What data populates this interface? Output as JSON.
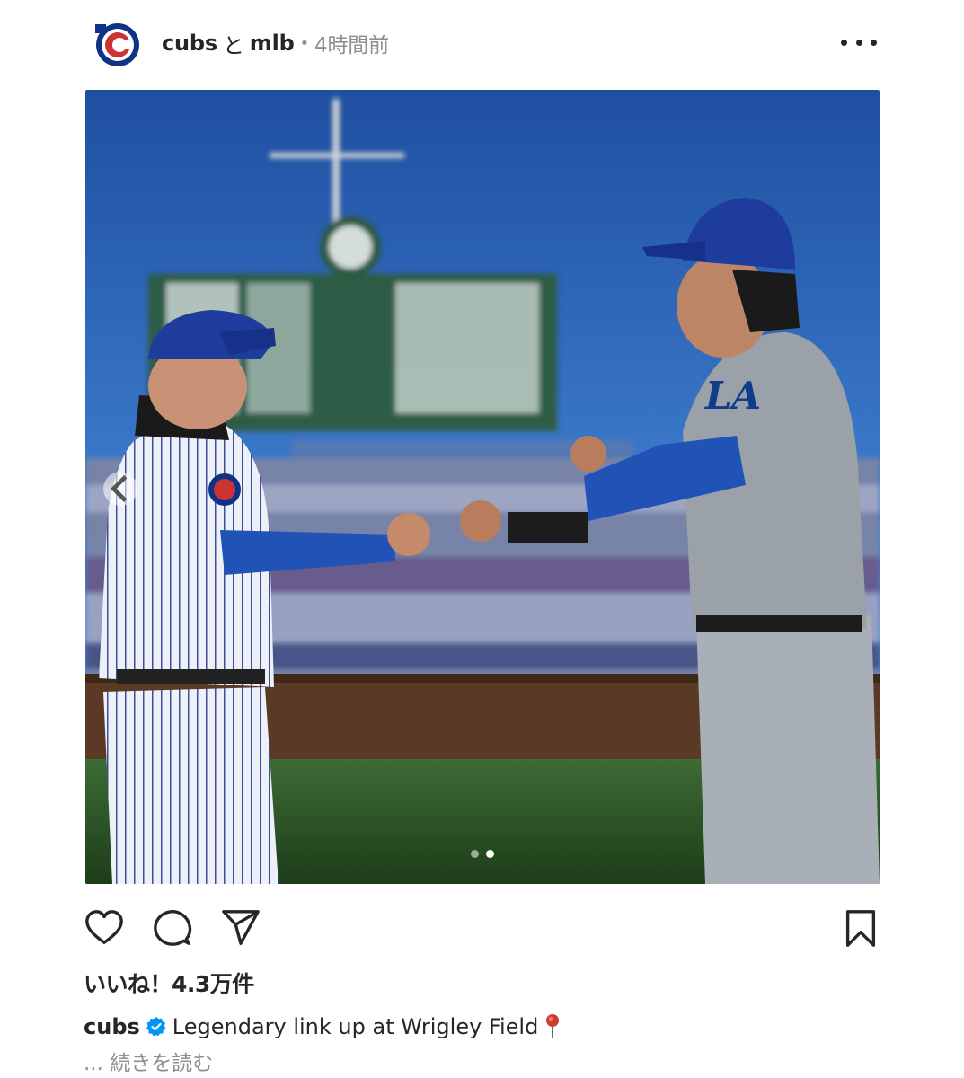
{
  "post": {
    "author": "cubs",
    "conjunction": "と",
    "collaborator": "mlb",
    "separator": "•",
    "time": "4時間前",
    "avatar_icon": "cubs-logo",
    "more_icon": "more-horizontal-icon"
  },
  "photo": {
    "description_icon": "post-photo",
    "carousel": {
      "current": 2,
      "total": 2
    },
    "prev_icon": "chevron-left-icon"
  },
  "actions": {
    "like_icon": "heart-icon",
    "comment_icon": "comment-icon",
    "share_icon": "send-icon",
    "save_icon": "bookmark-icon"
  },
  "likes_text": "いいね！4.3万件",
  "caption": {
    "user": "cubs",
    "verified_icon": "verified-badge-icon",
    "text": "Legendary link up at Wrigley Field",
    "emoji_icon": "pushpin-icon"
  },
  "more_link": "... 続きを読む",
  "colors": {
    "text": "#262626",
    "muted": "#8e8e8e",
    "verified": "#0095f6",
    "cubs_blue": "#0e3386",
    "cubs_red": "#cc3433"
  }
}
